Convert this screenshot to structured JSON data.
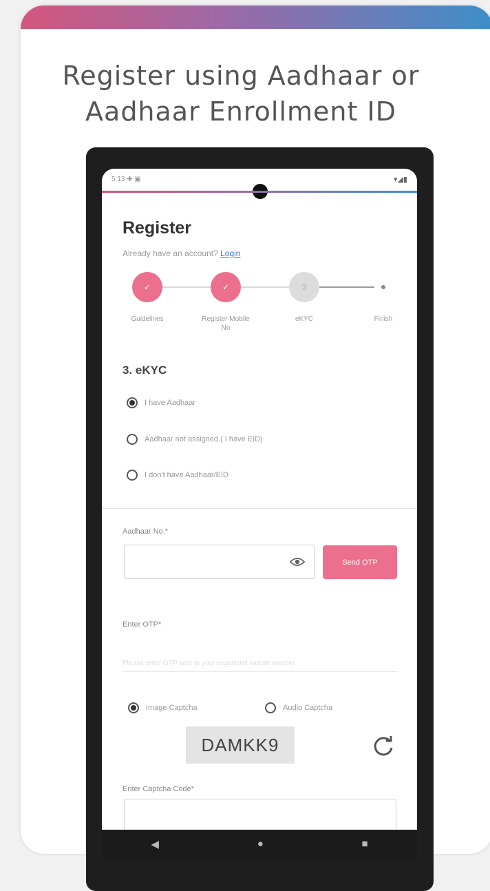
{
  "headline": {
    "line1": "Register using Aadhaar or",
    "line2": "Aadhaar Enrollment ID"
  },
  "statusbar": {
    "left": "5:13 ✚ ▣",
    "right": "▾◢▮"
  },
  "register": {
    "title": "Register",
    "already_text": "Already have an account?",
    "login_link": "Login"
  },
  "stepper": {
    "steps": [
      {
        "label": "Guidelines",
        "icon": "check-icon",
        "state": "done"
      },
      {
        "label": "Register Mobile No",
        "icon": "check-icon",
        "state": "done"
      },
      {
        "label": "eKYC",
        "icon": "step-number-3",
        "state": "current"
      },
      {
        "label": "Finish",
        "icon": "dot",
        "state": "pending"
      }
    ]
  },
  "ekyc": {
    "section_title": "3. eKYC",
    "options": [
      {
        "label": "I have Aadhaar",
        "selected": true
      },
      {
        "label": "Aadhaar not assigned ( I have EID)",
        "selected": false
      },
      {
        "label": "I don't have Aadhaar/EID",
        "selected": false
      }
    ]
  },
  "aadhaar": {
    "label": "Aadhaar No.*",
    "value": "",
    "send_otp_label": "Send OTP"
  },
  "otp": {
    "label": "Enter OTP*",
    "placeholder": "Please enter OTP sent to your registered mobile number"
  },
  "captcha": {
    "options": [
      {
        "label": "Image Captcha",
        "selected": true
      },
      {
        "label": "Audio Captcha",
        "selected": false
      }
    ],
    "code": "DAMKK9",
    "input_label": "Enter Captcha Code*"
  },
  "navbar": {
    "back": "◀",
    "home": "●",
    "recents": "■"
  },
  "colors": {
    "accent": "#ec6f8d",
    "gradient_start": "#d2577e",
    "gradient_end": "#3d8fc8"
  }
}
